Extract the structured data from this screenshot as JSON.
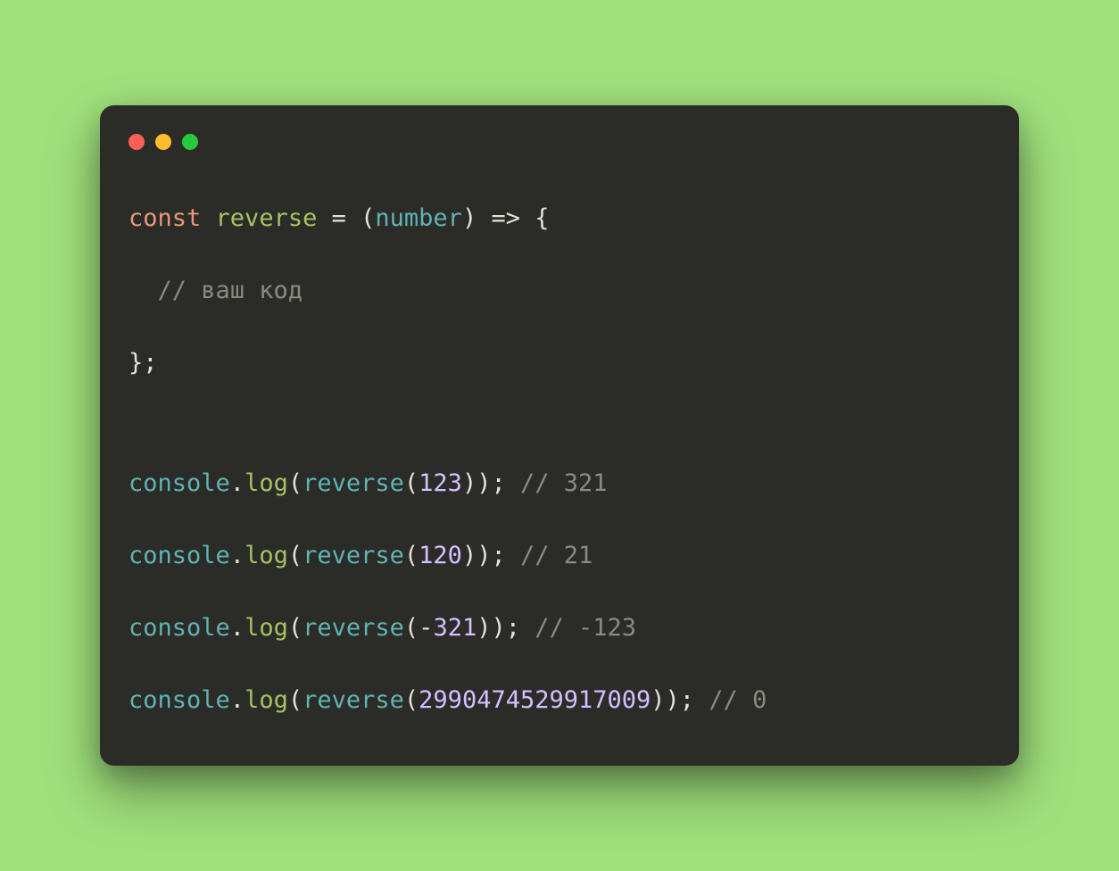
{
  "window": {
    "traffic_lights": [
      "red",
      "yellow",
      "green"
    ]
  },
  "code": {
    "lines": [
      [
        {
          "cls": "tok-kw",
          "t": "const"
        },
        {
          "cls": "tok-pun",
          "t": " "
        },
        {
          "cls": "tok-fn",
          "t": "reverse"
        },
        {
          "cls": "tok-pun",
          "t": " "
        },
        {
          "cls": "tok-op",
          "t": "="
        },
        {
          "cls": "tok-pun",
          "t": " ("
        },
        {
          "cls": "tok-id",
          "t": "number"
        },
        {
          "cls": "tok-pun",
          "t": ") "
        },
        {
          "cls": "tok-op",
          "t": "=>"
        },
        {
          "cls": "tok-pun",
          "t": " {"
        }
      ],
      "BLANK",
      [
        {
          "cls": "tok-pun",
          "t": "  "
        },
        {
          "cls": "tok-com",
          "t": "// ваш код"
        }
      ],
      "BLANK",
      [
        {
          "cls": "tok-pun",
          "t": "};"
        }
      ],
      "BLANK",
      "BLANK",
      "BLANK",
      [
        {
          "cls": "tok-id",
          "t": "console"
        },
        {
          "cls": "tok-pun",
          "t": "."
        },
        {
          "cls": "tok-fn",
          "t": "log"
        },
        {
          "cls": "tok-pun",
          "t": "("
        },
        {
          "cls": "tok-id",
          "t": "reverse"
        },
        {
          "cls": "tok-pun",
          "t": "("
        },
        {
          "cls": "tok-num",
          "t": "123"
        },
        {
          "cls": "tok-pun",
          "t": ")); "
        },
        {
          "cls": "tok-com",
          "t": "// 321"
        }
      ],
      "BLANK",
      [
        {
          "cls": "tok-id",
          "t": "console"
        },
        {
          "cls": "tok-pun",
          "t": "."
        },
        {
          "cls": "tok-fn",
          "t": "log"
        },
        {
          "cls": "tok-pun",
          "t": "("
        },
        {
          "cls": "tok-id",
          "t": "reverse"
        },
        {
          "cls": "tok-pun",
          "t": "("
        },
        {
          "cls": "tok-num",
          "t": "120"
        },
        {
          "cls": "tok-pun",
          "t": ")); "
        },
        {
          "cls": "tok-com",
          "t": "// 21"
        }
      ],
      "BLANK",
      [
        {
          "cls": "tok-id",
          "t": "console"
        },
        {
          "cls": "tok-pun",
          "t": "."
        },
        {
          "cls": "tok-fn",
          "t": "log"
        },
        {
          "cls": "tok-pun",
          "t": "("
        },
        {
          "cls": "tok-id",
          "t": "reverse"
        },
        {
          "cls": "tok-pun",
          "t": "("
        },
        {
          "cls": "tok-op",
          "t": "-"
        },
        {
          "cls": "tok-num",
          "t": "321"
        },
        {
          "cls": "tok-pun",
          "t": ")); "
        },
        {
          "cls": "tok-com",
          "t": "// -123"
        }
      ],
      "BLANK",
      [
        {
          "cls": "tok-id",
          "t": "console"
        },
        {
          "cls": "tok-pun",
          "t": "."
        },
        {
          "cls": "tok-fn",
          "t": "log"
        },
        {
          "cls": "tok-pun",
          "t": "("
        },
        {
          "cls": "tok-id",
          "t": "reverse"
        },
        {
          "cls": "tok-pun",
          "t": "("
        },
        {
          "cls": "tok-num",
          "t": "2990474529917009"
        },
        {
          "cls": "tok-pun",
          "t": ")); "
        },
        {
          "cls": "tok-com",
          "t": "// 0"
        }
      ]
    ]
  }
}
